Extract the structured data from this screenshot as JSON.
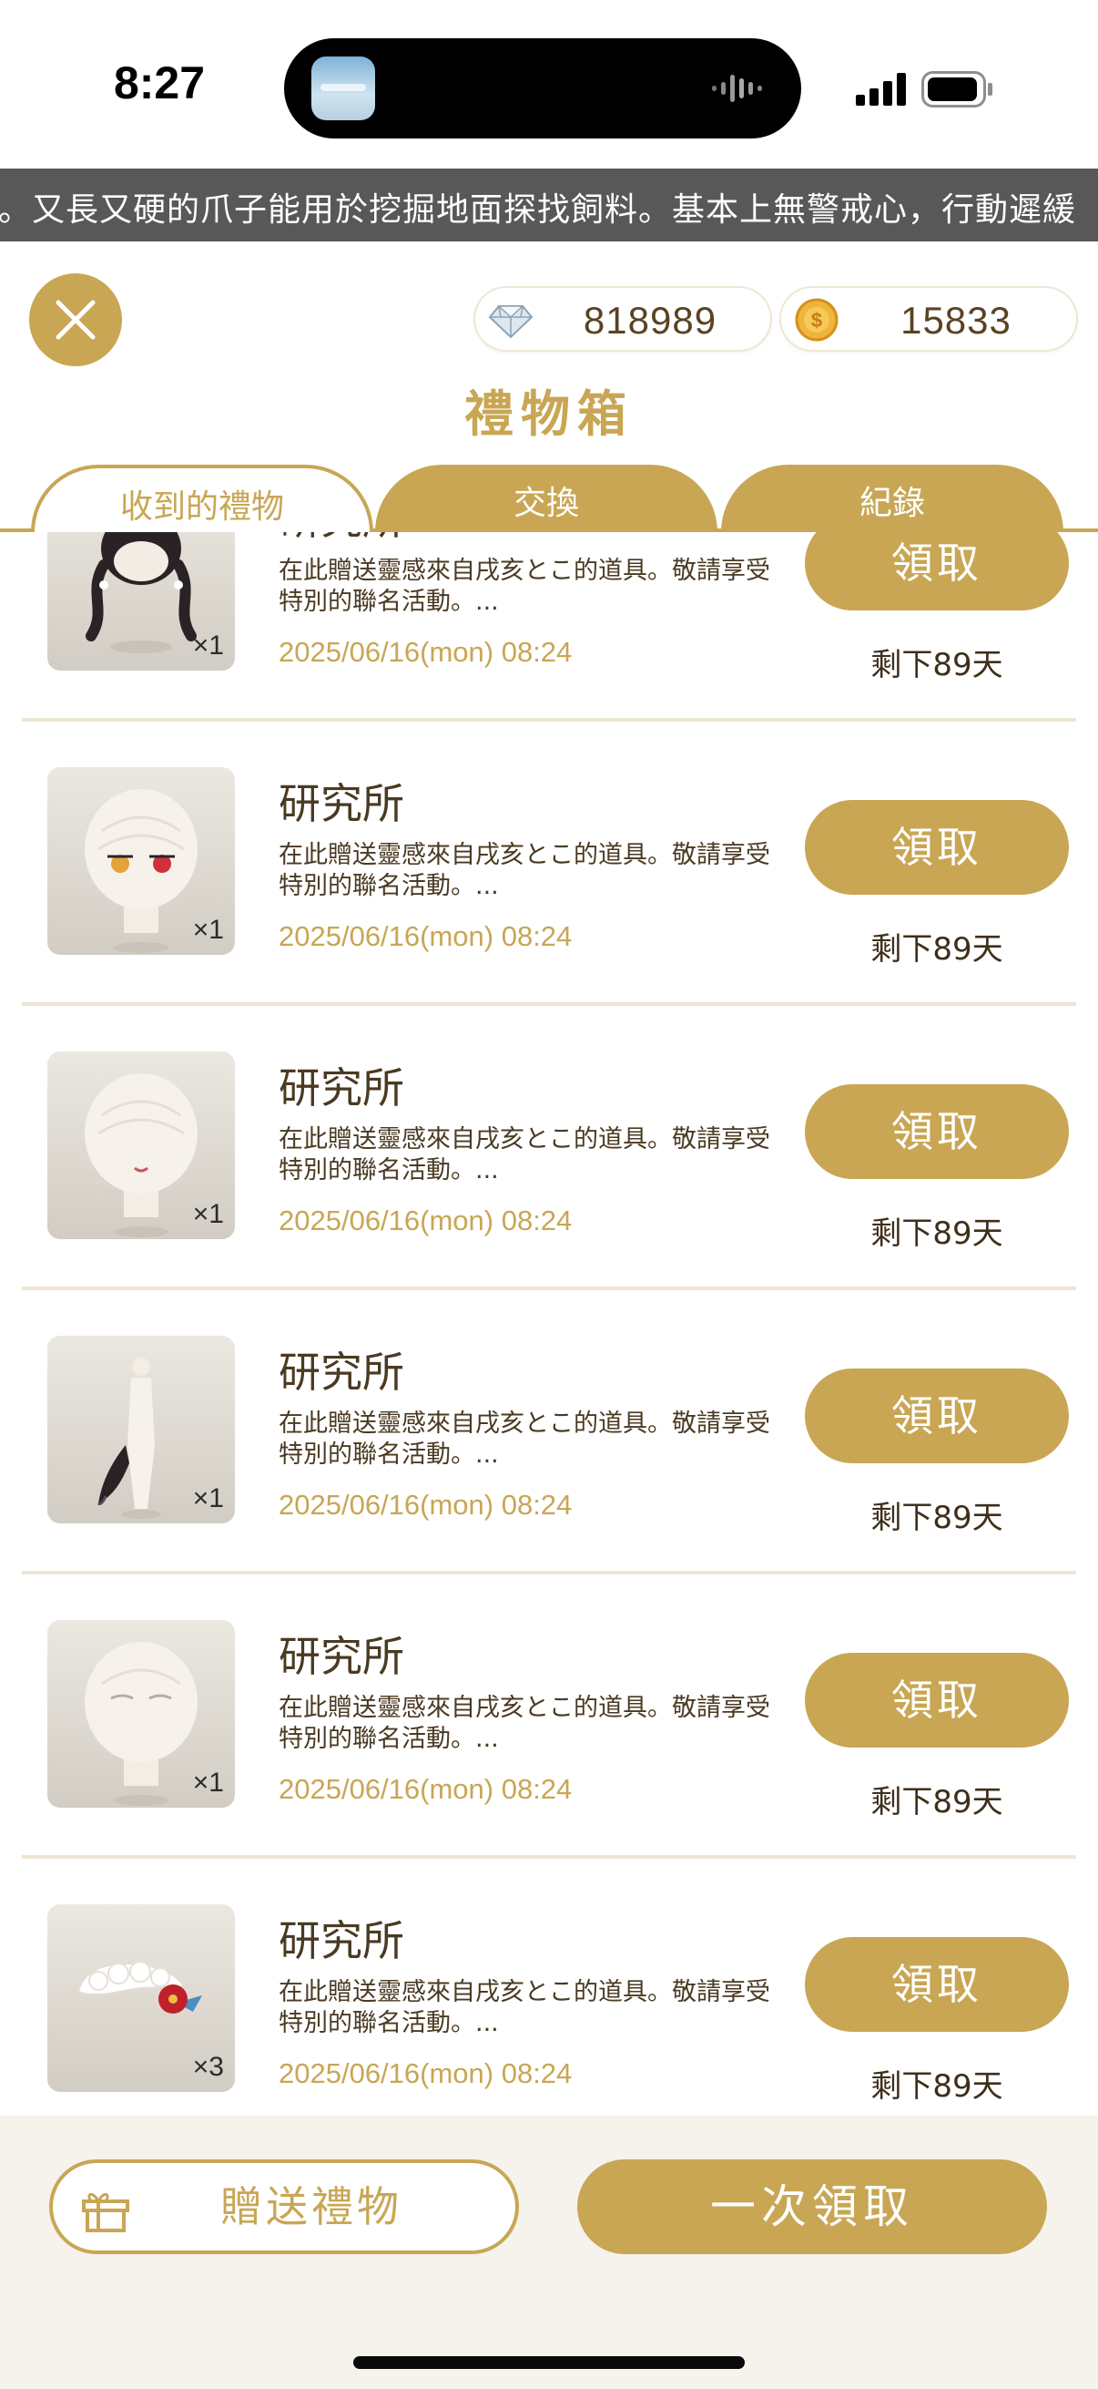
{
  "status_bar": {
    "time": "8:27"
  },
  "ticker": {
    "text": "。又長又硬的爪子能用於挖掘地面探找飼料。基本上無警戒心，行動遲緩"
  },
  "header": {
    "gems": "818989",
    "coins": "15833",
    "title": "禮物箱"
  },
  "tabs": [
    {
      "label": "收到的禮物",
      "active": true
    },
    {
      "label": "交換",
      "active": false
    },
    {
      "label": "紀錄",
      "active": false
    }
  ],
  "gifts": [
    {
      "sender": "研究所",
      "description": "在此贈送靈感來自戌亥とこ的道具。敬請享受特別的聯名活動。...",
      "date": "2025/06/16(mon) 08:24",
      "claim_label": "領取",
      "remaining": "剩下89天",
      "quantity": "×1",
      "item_icon": "hair-icon"
    },
    {
      "sender": "研究所",
      "description": "在此贈送靈感來自戌亥とこ的道具。敬請享受特別的聯名活動。...",
      "date": "2025/06/16(mon) 08:24",
      "claim_label": "領取",
      "remaining": "剩下89天",
      "quantity": "×1",
      "item_icon": "eyes-icon"
    },
    {
      "sender": "研究所",
      "description": "在此贈送靈感來自戌亥とこ的道具。敬請享受特別的聯名活動。...",
      "date": "2025/06/16(mon) 08:24",
      "claim_label": "領取",
      "remaining": "剩下89天",
      "quantity": "×1",
      "item_icon": "mouth-icon"
    },
    {
      "sender": "研究所",
      "description": "在此贈送靈感來自戌亥とこ的道具。敬請享受特別的聯名活動。...",
      "date": "2025/06/16(mon) 08:24",
      "claim_label": "領取",
      "remaining": "剩下89天",
      "quantity": "×1",
      "item_icon": "tail-icon"
    },
    {
      "sender": "研究所",
      "description": "在此贈送靈感來自戌亥とこ的道具。敬請享受特別的聯名活動。...",
      "date": "2025/06/16(mon) 08:24",
      "claim_label": "領取",
      "remaining": "剩下89天",
      "quantity": "×1",
      "item_icon": "eyebrows-icon"
    },
    {
      "sender": "研究所",
      "description": "在此贈送靈感來自戌亥とこ的道具。敬請享受特別的聯名活動。...",
      "date": "2025/06/16(mon) 08:24",
      "claim_label": "領取",
      "remaining": "剩下89天",
      "quantity": "×3",
      "item_icon": "headdress-icon"
    }
  ],
  "footer": {
    "send_gift_label": "贈送禮物",
    "claim_all_label": "一次領取"
  },
  "colors": {
    "accent": "#c8a654",
    "text_dark": "#4a3a22",
    "ticker_bg": "#585858",
    "footer_bg": "#f6f2ec"
  }
}
